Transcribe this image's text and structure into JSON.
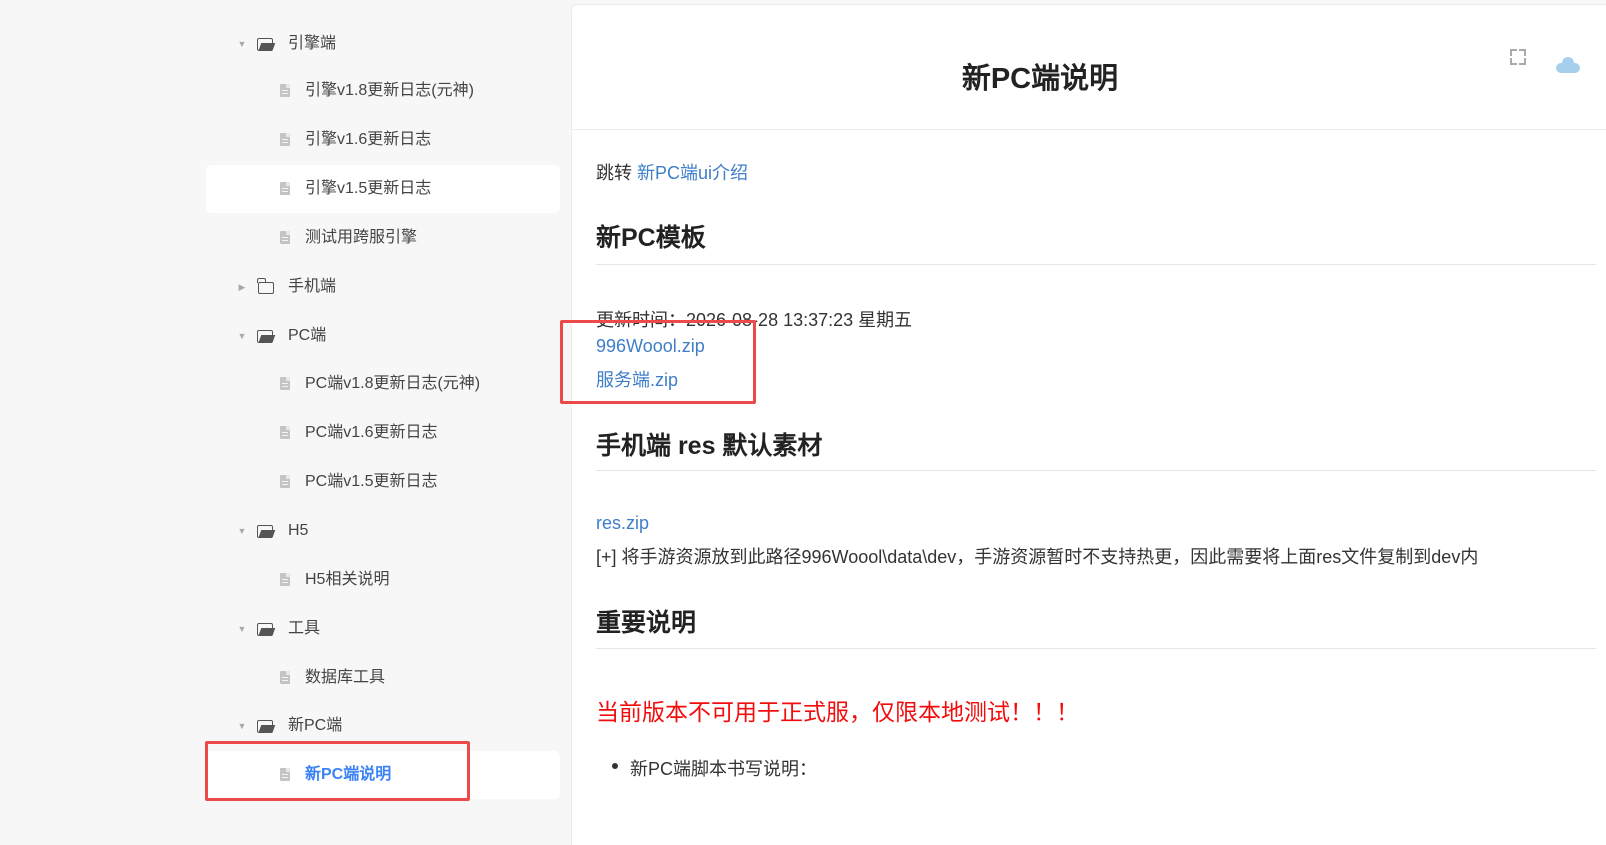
{
  "sidebar": {
    "items": [
      {
        "type": "folder-open",
        "label": "引擎端",
        "level": 0
      },
      {
        "type": "doc",
        "label": "引擎v1.8更新日志(元神)",
        "level": 1
      },
      {
        "type": "doc",
        "label": "引擎v1.6更新日志",
        "level": 1
      },
      {
        "type": "doc",
        "label": "引擎v1.5更新日志",
        "level": 1
      },
      {
        "type": "doc",
        "label": "测试用跨服引擎",
        "level": 1
      },
      {
        "type": "folder-closed",
        "label": "手机端",
        "level": 0
      },
      {
        "type": "folder-open",
        "label": "PC端",
        "level": 0
      },
      {
        "type": "doc",
        "label": "PC端v1.8更新日志(元神)",
        "level": 1
      },
      {
        "type": "doc",
        "label": "PC端v1.6更新日志",
        "level": 1
      },
      {
        "type": "doc",
        "label": "PC端v1.5更新日志",
        "level": 1
      },
      {
        "type": "folder-open",
        "label": "H5",
        "level": 0
      },
      {
        "type": "doc",
        "label": "H5相关说明",
        "level": 1
      },
      {
        "type": "folder-open",
        "label": "工具",
        "level": 0
      },
      {
        "type": "doc",
        "label": "数据库工具",
        "level": 1
      },
      {
        "type": "folder-open",
        "label": "新PC端",
        "level": 0
      },
      {
        "type": "doc",
        "label": "新PC端说明",
        "level": 1,
        "active": true
      }
    ]
  },
  "main": {
    "title": "新PC端说明",
    "jump_prefix": "跳转",
    "jump_link": "新PC端ui介绍",
    "sections": {
      "template": {
        "heading": "新PC模板",
        "update_time": "更新时间：2026-08-28 13:37:23 星期五",
        "files": [
          "996Woool.zip",
          "服务端.zip"
        ]
      },
      "mobile_res": {
        "heading": "手机端 res 默认素材",
        "file": "res.zip",
        "note": "[+] 将手游资源放到此路径996Woool\\data\\dev，手游资源暂时不支持热更，因此需要将上面res文件复制到dev内"
      },
      "important": {
        "heading": "重要说明",
        "warning": "当前版本不可用于正式服，仅限本地测试！！！",
        "bullet": "新PC端脚本书写说明："
      }
    }
  },
  "colors": {
    "link": "#3f7ec8",
    "warning": "#f20d0d",
    "active": "#3b82f6",
    "highlight_box": "#ec4a4a"
  }
}
